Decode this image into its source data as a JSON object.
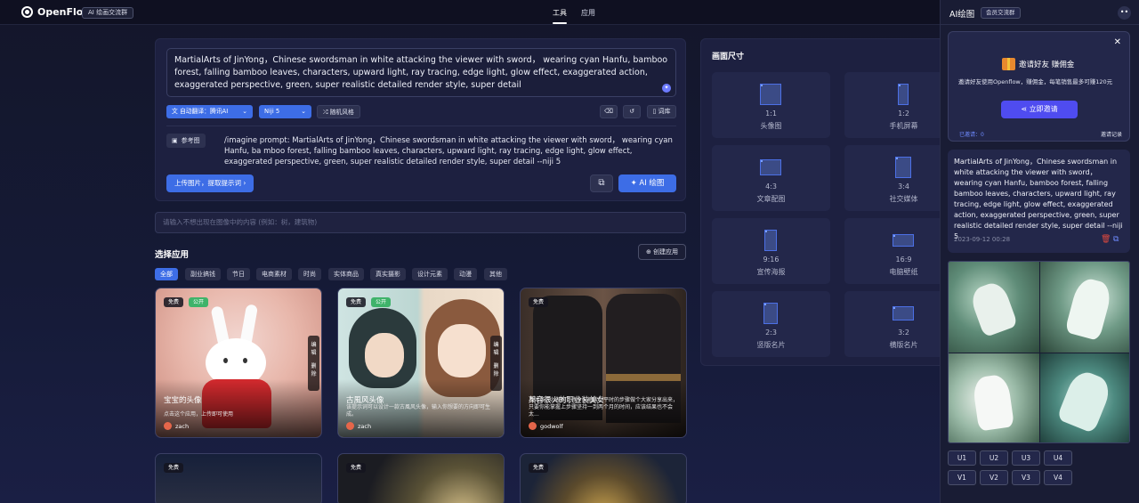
{
  "header": {
    "brand": "OpenFlow",
    "group_badge": "AI 绘画交流群",
    "nav": [
      {
        "label": "工具",
        "active": true
      },
      {
        "label": "应用",
        "active": false
      }
    ]
  },
  "prompt": {
    "text": "MartialArts of JinYong，Chinese swordsman in white attacking the viewer with sword， wearing cyan Hanfu, bamboo forest, falling bamboo leaves, characters, upward light, ray tracing, edge light, glow effect, exaggerated action, exaggerated perspective, green, super realistic detailed render style, super detail",
    "translate_label": "自动翻译",
    "translate_engine": "腾讯AI",
    "model": "Niji 5",
    "random_style": "随机风格",
    "lexicon": "词库",
    "ref_label": "参考图",
    "imagine": "/imagine prompt: MartialArts of JinYong，Chinese swordsman in white attacking the viewer with sword， wearing cyan Hanfu, ba mboo forest, falling bamboo leaves, characters, upward light, ray tracing, edge light, glow effect, exaggerated perspective, green, super realistic detailed render style, super detail --niji 5",
    "upload_btn": "上传图片，提取提示词",
    "draw_btn": "AI 绘图"
  },
  "negative": {
    "placeholder": "请输入不想出现在图像中的内容 (例如：树，建筑物)"
  },
  "apps": {
    "title": "选择应用",
    "create_btn": "创建应用",
    "categories": [
      "全部",
      "副业搞钱",
      "节日",
      "电商素材",
      "时尚",
      "实体商品",
      "真实摄影",
      "设计元素",
      "动漫",
      "其他"
    ],
    "cards": [
      {
        "tags": [
          "免费",
          "公开"
        ],
        "title": "宝宝的头像",
        "desc": "点击这个应用，上传即可使用",
        "user": "zach",
        "actions": [
          "编辑",
          "删除"
        ]
      },
      {
        "tags": [
          "免费",
          "公开"
        ],
        "title": "古風风头像",
        "desc": "该提示词可以设计一款古風风头像，输入你想要的方向即可生成。",
        "user": "zach",
        "actions": [
          "编辑",
          "删除"
        ]
      },
      {
        "tags": [
          "免费"
        ],
        "title": "某音很火的职业装美女",
        "desc": "具体该怎么做呢？我今天把我们平时的步骤做个大家分享出来，只要你能掌握上步骤坚持一到两个月的时间，应该结果也不会太...",
        "user": "godwolf",
        "actions": []
      },
      {
        "tags": [
          "免费"
        ],
        "title": "",
        "desc": "",
        "user": "",
        "actions": []
      },
      {
        "tags": [
          "免费"
        ],
        "title": "",
        "desc": "",
        "user": "",
        "actions": []
      },
      {
        "tags": [
          "免费"
        ],
        "title": "",
        "desc": "",
        "user": "",
        "actions": []
      }
    ]
  },
  "sizes": {
    "title": "画面尺寸",
    "items": [
      {
        "ratio": "1:1",
        "name": "头像图"
      },
      {
        "ratio": "1:2",
        "name": "手机屏幕"
      },
      {
        "ratio": "4:3",
        "name": "文章配图"
      },
      {
        "ratio": "3:4",
        "name": "社交媒体"
      },
      {
        "ratio": "9:16",
        "name": "宣传海报"
      },
      {
        "ratio": "16:9",
        "name": "电脑壁纸"
      },
      {
        "ratio": "2:3",
        "name": "竖版名片"
      },
      {
        "ratio": "3:2",
        "name": "横版名片"
      }
    ]
  },
  "right": {
    "title": "AI绘图",
    "group_btn": "会员交流群",
    "more": "••",
    "invite": {
      "title": "邀请好友 赚佣金",
      "desc": "邀请好友使用Openflow，赚佣金，每笔销售最多可赚120元",
      "button": "立即邀请",
      "count": "已邀请：0",
      "records": "邀请记录"
    },
    "history": {
      "text": "MartialArts of JinYong，Chinese swordsman in white attacking the viewer with sword， wearing cyan Hanfu, bamboo forest, falling bamboo leaves, characters, upward light, ray tracing, edge light, glow effect, exaggerated action, exaggerated perspective, green, super realistic detailed render style, super detail --niji 5",
      "date": "2023-09-12 00:28"
    },
    "upscale": [
      "U1",
      "U2",
      "U3",
      "U4"
    ],
    "variation": [
      "V1",
      "V2",
      "V3",
      "V4"
    ]
  }
}
